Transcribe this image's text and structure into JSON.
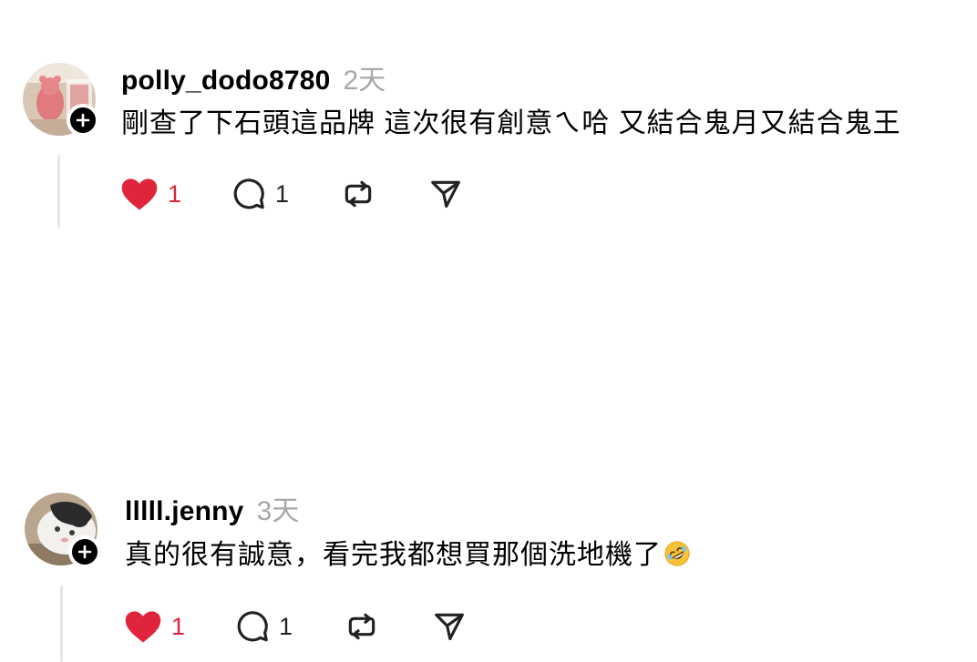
{
  "comments": [
    {
      "username": "polly_dodo8780",
      "time": "2天",
      "text": "剛查了下石頭這品牌 這次很有創意ㄟ哈 又結合鬼月又結合鬼王",
      "likes": "1",
      "replies": "1",
      "liked": true
    },
    {
      "username": "lllll.jenny",
      "time": "3天",
      "text": "真的很有誠意，看完我都想買那個洗地機了",
      "emoji": "rolling-on-floor-laughing-emoji",
      "likes": "1",
      "replies": "1",
      "liked": true
    }
  ],
  "colors": {
    "like": "#e0243b",
    "muted": "#a8a8a8",
    "thread_line": "#e6e6e6"
  }
}
